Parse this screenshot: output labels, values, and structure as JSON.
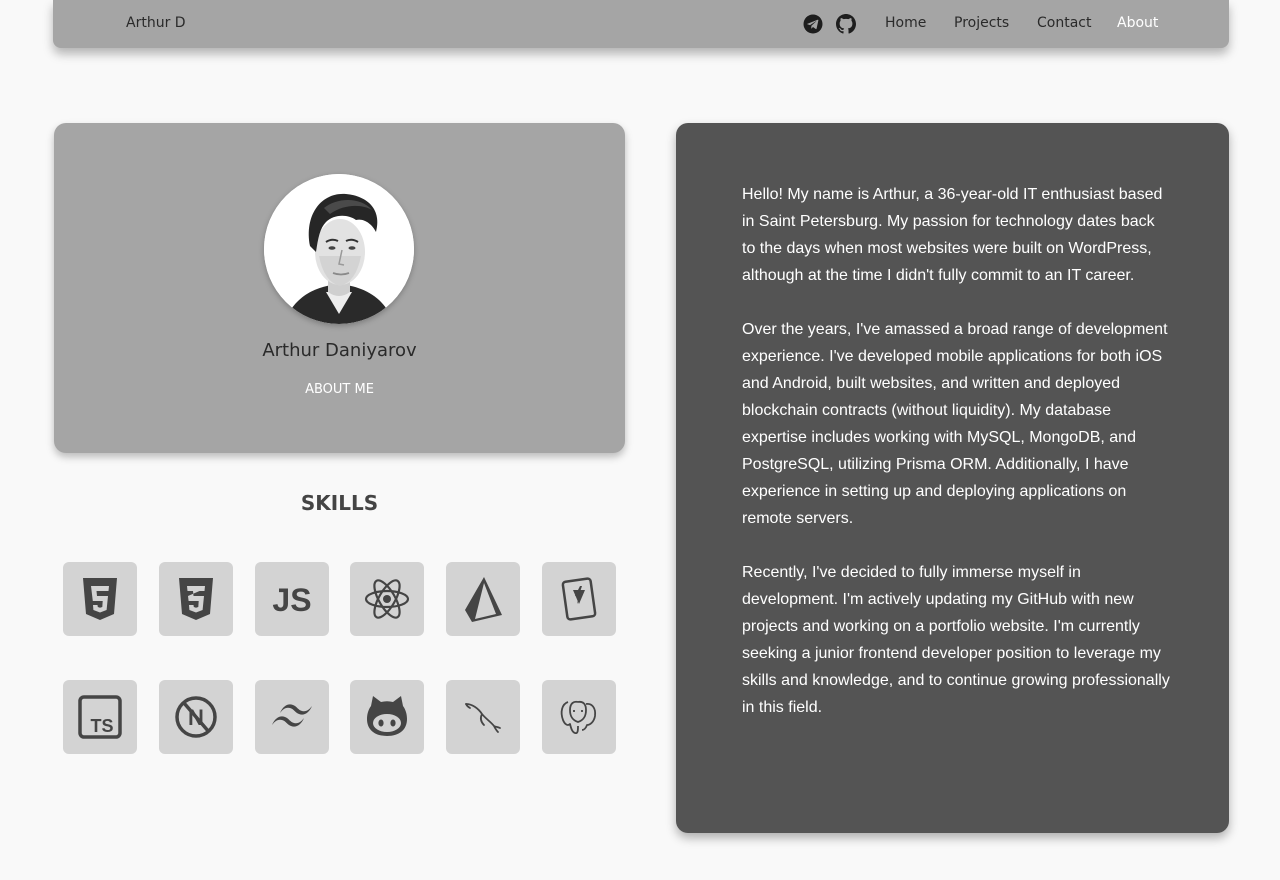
{
  "navbar": {
    "brand": "Arthur D",
    "social": [
      {
        "name": "telegram-icon"
      },
      {
        "name": "github-icon"
      }
    ],
    "links": [
      {
        "label": "Home"
      },
      {
        "label": "Projects"
      },
      {
        "label": "Contact"
      },
      {
        "label": "About",
        "active": true
      }
    ]
  },
  "profile": {
    "name": "Arthur Daniyarov",
    "about_label": "ABOUT ME"
  },
  "skills": {
    "title": "SKILLS",
    "items": [
      {
        "icon": "html5-icon"
      },
      {
        "icon": "css3-icon"
      },
      {
        "icon": "javascript-icon"
      },
      {
        "icon": "react-icon"
      },
      {
        "icon": "prisma-icon"
      },
      {
        "icon": "vite-icon"
      },
      {
        "icon": "typescript-icon"
      },
      {
        "icon": "nextjs-icon"
      },
      {
        "icon": "tailwind-icon"
      },
      {
        "icon": "github-icon"
      },
      {
        "icon": "mysql-icon"
      },
      {
        "icon": "postgresql-icon"
      }
    ],
    "text": {
      "javascript": "JS",
      "typescript": "TS",
      "nextjs": "N"
    }
  },
  "bio": {
    "paragraphs": [
      "Hello! My name is Arthur, a 36-year-old IT enthusiast based in Saint Petersburg. My passion for technology dates back to the days when most websites were built on WordPress, although at the time I didn't fully commit to an IT career.",
      "Over the years, I've amassed a broad range of development experience. I've developed mobile applications for both iOS and Android, built websites, and written and deployed blockchain contracts (without liquidity). My database expertise includes working with MySQL, MongoDB, and PostgreSQL, utilizing Prisma ORM. Additionally, I have experience in setting up and deploying applications on remote servers.",
      "Recently, I've decided to fully immerse myself in development. I'm actively updating my GitHub with new projects and working on a portfolio website. I'm currently seeking a junior frontend developer position to leverage my skills and knowledge, and to continue growing professionally in this field."
    ]
  },
  "colors": {
    "navbar_bg": "#a5a5a5",
    "profile_card_bg": "#a5a5a5",
    "bio_card_bg": "#545454",
    "skill_tile_bg": "#d3d3d3",
    "page_bg": "#f9f9f9"
  }
}
